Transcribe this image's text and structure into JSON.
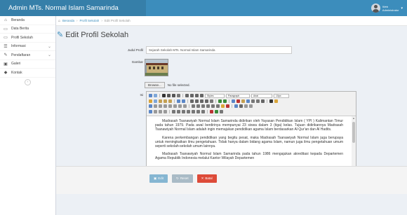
{
  "app": {
    "title": "Admin MTs. Normal Islam Samarinda",
    "user_line1": "Web",
    "user_line2": "Administrator"
  },
  "sidebar": {
    "items": [
      {
        "label": "Beranda",
        "icon": "home-icon"
      },
      {
        "label": "Data Berita",
        "icon": "document-icon"
      },
      {
        "label": "Profil Sekolah",
        "icon": "document-icon"
      },
      {
        "label": "Informasi",
        "icon": "list-icon",
        "has_chevron": true
      },
      {
        "label": "Pendaftaran",
        "icon": "edit-icon",
        "has_chevron": true
      },
      {
        "label": "Galeri",
        "icon": "image-icon"
      },
      {
        "label": "Kontak",
        "icon": "tag-icon"
      }
    ]
  },
  "breadcrumb": {
    "home": "Beranda",
    "parent": "Profil Sekolah",
    "current": "Edit Profil Sekolah"
  },
  "page": {
    "title": "Edit Profil Sekolah"
  },
  "form": {
    "judul_label": "Judul Profil",
    "judul_value": "Sejarah Sekolah MTs. Normal Islam Samarinda",
    "gambar_label": "Gambar",
    "browse_label": "Browse...",
    "no_file": "No file selected.",
    "isi_label": "Isi",
    "toolbar": {
      "styles": "Styles",
      "format": "Paragraph",
      "font": "Arial",
      "size": "10px"
    },
    "paragraphs": [
      "Madrasah Tsanawiyah Normal Islam Samarinda didirikan oleh Yayasan Pendidikan Islam ( YPI ) Kalimantan Timur pada tahun 1979. Pada awal berdirinya mempunyai 23 siswa dalam 3 (tiga) kelas. Tujuan didirikannya Madrasah Tsanawiyah Normal Islam adalah ingin memajukan pendidikan agama Islam berdasarkan Al Qur'an dan Al Hadits.",
      "Karena perkembangan pendidikan yang begitu pesat, maka Madrasah Tsanawiyah Normal Islam juga berupaya untuk meningkatkan ilmu pengetahuan. Tidak hanya dalam bidang agama Islam, namun juga ilmu pengetahuan umum seperti sekolah-sekolah umum lainnya.",
      "Madrasah Tsanawiyah Normal Islam Samarinda pada tahun 1986 mengajukan akreditasi kepada Departemen Agama Republik Indonesia melalui Kantor Wilayah Departemen"
    ],
    "path_text": "Path: p » span"
  },
  "buttons": {
    "edit": "Edit",
    "reset": "Reset",
    "cancel": "Batal"
  },
  "colors": {
    "header": "#3c8dbc",
    "brand": "#367fa9",
    "danger": "#dd4b39"
  }
}
